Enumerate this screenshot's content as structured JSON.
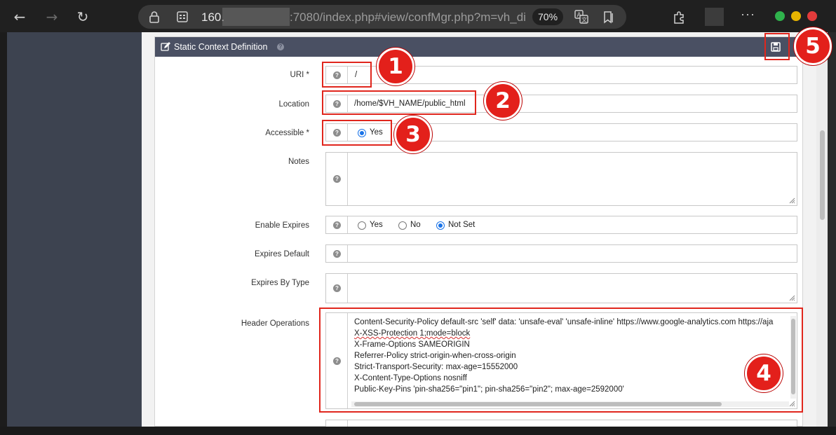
{
  "browser": {
    "url_host": "160.",
    "url_rest": ":7080/index.php#view/confMgr.php?m=vh_di",
    "zoom": "70%",
    "more_label": "···"
  },
  "panel": {
    "title": "Static Context Definition"
  },
  "form": {
    "uri": {
      "label": "URI *",
      "value": "/"
    },
    "location": {
      "label": "Location",
      "value": "/home/$VH_NAME/public_html"
    },
    "accessible": {
      "label": "Accessible *",
      "option": "Yes"
    },
    "notes": {
      "label": "Notes",
      "value": ""
    },
    "enable_expires": {
      "label": "Enable Expires",
      "options": [
        "Yes",
        "No",
        "Not Set"
      ],
      "selected": "Not Set"
    },
    "expires_default": {
      "label": "Expires Default",
      "value": ""
    },
    "expires_by_type": {
      "label": "Expires By Type",
      "value": ""
    },
    "header_operations": {
      "label": "Header Operations",
      "lines": [
        "Content-Security-Policy default-src 'self' data: 'unsafe-eval' 'unsafe-inline' https://www.google-analytics.com https://aja",
        "X-XSS-Protection 1;mode=block",
        "X-Frame-Options SAMEORIGIN",
        "Referrer-Policy strict-origin-when-cross-origin",
        "Strict-Transport-Security: max-age=15552000",
        "X-Content-Type-Options nosniff",
        "Public-Key-Pins 'pin-sha256=\"pin1\"; pin-sha256=\"pin2\"; max-age=2592000'"
      ]
    }
  },
  "annotations": [
    "1",
    "2",
    "3",
    "4",
    "5"
  ],
  "colors": {
    "highlight": "#e0261d",
    "badge": "#e3201b",
    "header": "#4a5063",
    "sidebar": "#3d4350"
  },
  "icons": [
    "back-icon",
    "forward-icon",
    "reload-icon",
    "lock-icon",
    "tabs-icon",
    "translate-icon",
    "reading-list-icon",
    "extensions-icon",
    "edit-icon",
    "help-icon",
    "save-icon"
  ]
}
